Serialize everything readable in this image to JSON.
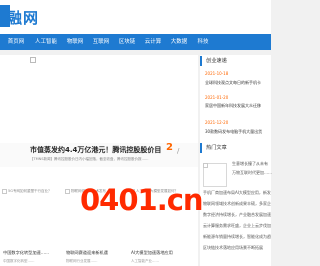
{
  "header": {
    "logo_text": "融网"
  },
  "nav": {
    "items": [
      "首页网",
      "人工智能",
      "物联网",
      "互联网",
      "区块链",
      "云计算",
      "大数据",
      "科技"
    ]
  },
  "carousel": {
    "title": "市值蒸发约4.4万亿港元！腾讯控股股价目",
    "desc": "【TMNS新闻】腾讯控股股价日内小幅回落，截至收盘，腾讯控股股价报……",
    "page": "2",
    "arrow": "/"
  },
  "ad": {
    "text": "0401.cn"
  },
  "thumbs": [
    {
      "cap": "5G专网如何重塑千行百业？",
      "title": "中国数字化转型加速……",
      "sub": "中国数字化转型……"
    },
    {
      "cap": "物联网领域新技术发布",
      "title": "物联网赛道迎来新机遇",
      "sub": "物联网行业发展……"
    },
    {
      "cap": "人工智能大模型发展如何？",
      "title": "AI大模型加速落地应用",
      "sub": "人工智能产业……"
    }
  ],
  "sidebar": {
    "latest_heading": "创业速递",
    "latest": [
      {
        "date": "2021-10-18",
        "title": "全球科技观点文每日的新手机卡"
      },
      {
        "date": "2021-01-20",
        "title": "家居中国新年科技发展大众迁移"
      },
      {
        "date": "2021-12-20",
        "title": "30款数码发布电脑手机大量出货"
      }
    ],
    "hot_heading": "热门文章",
    "hot_side_lines": [
      "生意增长撞了从未有",
      "万物互联时代更加……"
    ],
    "hot_list": [
      "手机厂商加速布局AI大模型应用，新发布",
      "物联网领域技术创新成果丰硕，多家企业",
      "数字经济持续增长，产业融合发展加速",
      "云计算服务需求旺盛，企业上云步伐加快",
      "新能源车销量持续增长，智能化成为趋势",
      "区块链技术落地应用场景不断拓展"
    ]
  }
}
